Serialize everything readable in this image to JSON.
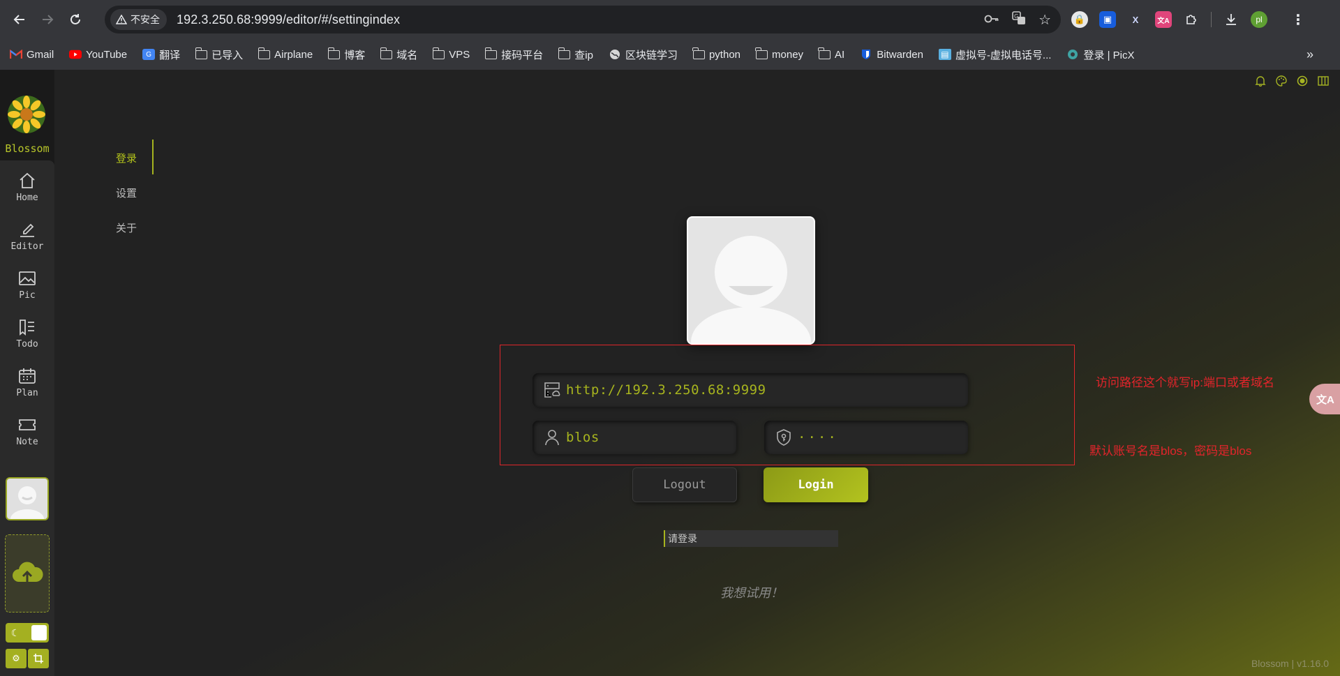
{
  "browser": {
    "security_label": "不安全",
    "url": "192.3.250.68:9999/editor/#/settingindex",
    "profile_initial": "pl",
    "bookmarks": [
      {
        "label": "Gmail",
        "icon": "gmail-icon"
      },
      {
        "label": "YouTube",
        "icon": "youtube-icon"
      },
      {
        "label": "翻译",
        "icon": "google-translate-icon"
      },
      {
        "label": "已导入",
        "icon": "folder-icon"
      },
      {
        "label": "Airplane",
        "icon": "folder-icon"
      },
      {
        "label": "博客",
        "icon": "folder-icon"
      },
      {
        "label": "域名",
        "icon": "folder-icon"
      },
      {
        "label": "VPS",
        "icon": "folder-icon"
      },
      {
        "label": "接码平台",
        "icon": "folder-icon"
      },
      {
        "label": "查ip",
        "icon": "folder-icon"
      },
      {
        "label": "区块链学习",
        "icon": "globe-icon"
      },
      {
        "label": "python",
        "icon": "folder-icon"
      },
      {
        "label": "money",
        "icon": "folder-icon"
      },
      {
        "label": "AI",
        "icon": "folder-icon"
      },
      {
        "label": "Bitwarden",
        "icon": "bitwarden-icon"
      },
      {
        "label": "虚拟号-虚拟电话号...",
        "icon": "site-icon"
      },
      {
        "label": "登录 | PicX",
        "icon": "picx-icon"
      }
    ]
  },
  "app": {
    "logo_text": "Blossom",
    "nav": [
      {
        "label": "Home",
        "icon": "home-icon"
      },
      {
        "label": "Editor",
        "icon": "editor-icon"
      },
      {
        "label": "Pic",
        "icon": "picture-icon"
      },
      {
        "label": "Todo",
        "icon": "todo-icon"
      },
      {
        "label": "Plan",
        "icon": "calendar-icon"
      },
      {
        "label": "Note",
        "icon": "ticket-icon"
      }
    ],
    "sub_menu": [
      "登录",
      "设置",
      "关于"
    ],
    "active_sub_menu": "登录",
    "accent_color": "#a7b41e",
    "annotation_color": "#e3242b"
  },
  "login": {
    "server_url": "http://192.3.250.68:9999",
    "username": "blos",
    "password_masked": "····",
    "logout_label": "Logout",
    "login_label": "Login",
    "status_text": "请登录",
    "try_link": "我想试用！"
  },
  "annotations": {
    "url_note": "访问路径这个就写ip:端口或者域名",
    "account_note": "默认账号名是blos，密码是blos"
  },
  "footer": {
    "version": "Blossom | v1.16.0"
  },
  "floating": {
    "translate_label": "文A"
  }
}
